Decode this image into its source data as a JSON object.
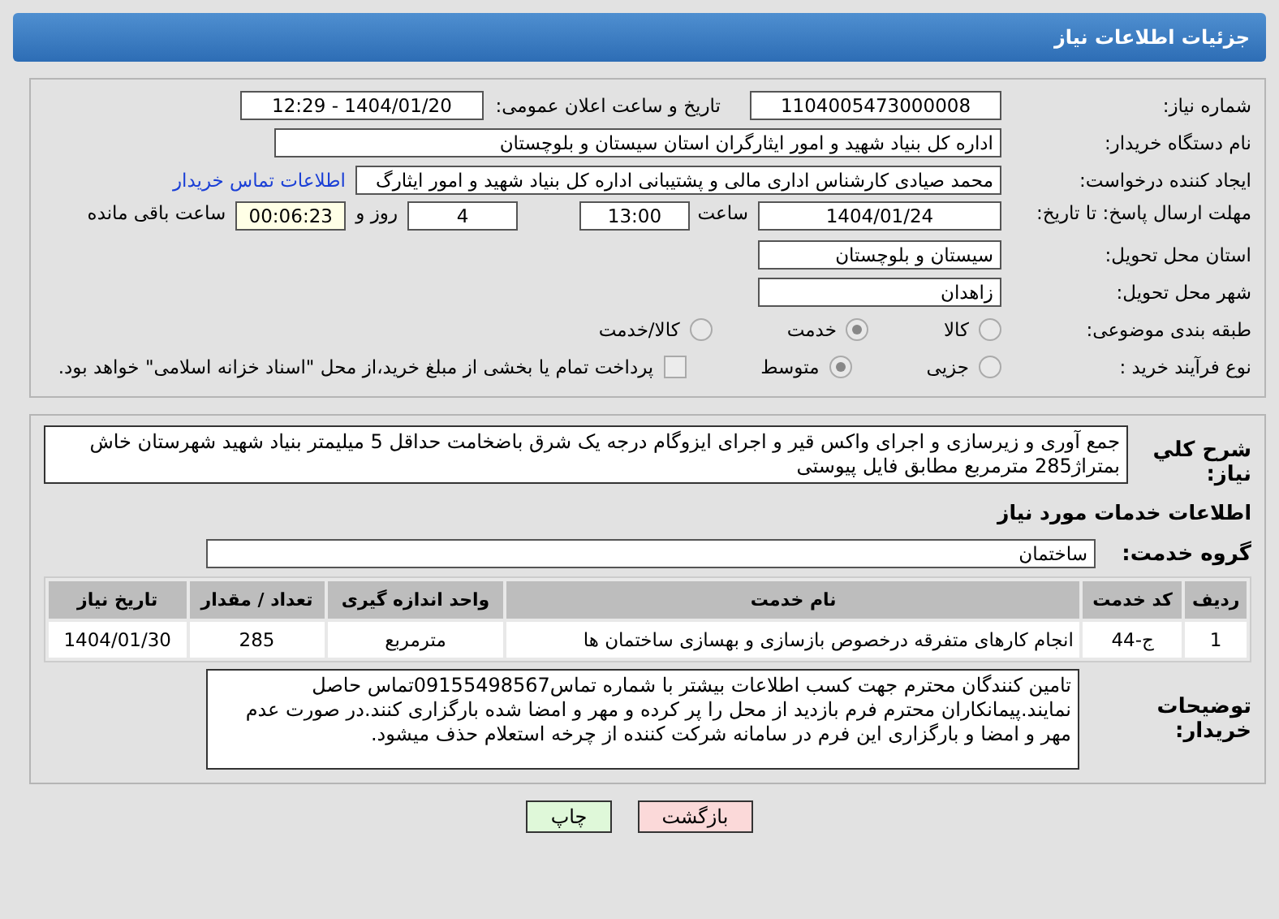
{
  "header": {
    "title": "جزئیات اطلاعات نیاز"
  },
  "details": {
    "need_number": {
      "label": "شماره نیاز:",
      "value": "1104005473000008"
    },
    "announce": {
      "label": "تاریخ و ساعت اعلان عمومی:",
      "value": "1404/01/20 - 12:29"
    },
    "buyer": {
      "label": "نام دستگاه خریدار:",
      "value": "اداره کل بنیاد شهید و امور ایثارگران استان سیستان و بلوچستان"
    },
    "creator": {
      "label": "ایجاد کننده درخواست:",
      "value": "محمد صیادی کارشناس اداری مالی و پشتیبانی اداره کل بنیاد شهید و امور ایثارگ",
      "link": "اطلاعات تماس خریدار"
    },
    "deadline": {
      "label": "مهلت ارسال پاسخ: تا تاریخ:",
      "date": "1404/01/24",
      "time_label": "ساعت",
      "time": "13:00",
      "days": "4",
      "days_label": "روز و",
      "remaining": "00:06:23",
      "remaining_label": "ساعت باقی مانده"
    },
    "province": {
      "label": "استان محل تحویل:",
      "value": "سیستان و بلوچستان"
    },
    "city": {
      "label": "شهر محل تحویل:",
      "value": "زاهدان"
    },
    "category": {
      "label": "طبقه بندی موضوعی:",
      "options": [
        {
          "label": "کالا",
          "selected": false
        },
        {
          "label": "خدمت",
          "selected": true
        },
        {
          "label": "کالا/خدمت",
          "selected": false
        }
      ]
    },
    "process": {
      "label": "نوع فرآیند خرید :",
      "options": [
        {
          "label": "جزیی",
          "selected": false
        },
        {
          "label": "متوسط",
          "selected": true
        }
      ],
      "payment": {
        "label": "پرداخت تمام یا بخشی از مبلغ خرید،از محل \"اسناد خزانه اسلامی\" خواهد بود.",
        "checked": false
      }
    }
  },
  "needs": {
    "summary": {
      "label": "شرح کلي نياز:",
      "value": "جمع آوری و زیرسازی و اجرای واکس قیر و اجرای ایزوگام درجه یک شرق باضخامت حداقل 5 میلیمتر بنیاد شهید شهرستان خاش بمتراژ285 مترمربع مطابق فایل پیوستی"
    },
    "section_title": "اطلاعات خدمات مورد نیاز",
    "service_group": {
      "label": "گروه خدمت:",
      "value": "ساختمان"
    },
    "table": {
      "columns": [
        "ردیف",
        "کد خدمت",
        "نام خدمت",
        "واحد اندازه گیری",
        "تعداد / مقدار",
        "تاریخ نیاز"
      ],
      "rows": [
        [
          "1",
          "ج-44",
          "انجام کارهای متفرقه درخصوص بازسازی و بهسازی ساختمان ها",
          "مترمربع",
          "285",
          "1404/01/30"
        ]
      ]
    },
    "buyer_notes": {
      "label": "توضیحات خریدار:",
      "value": "تامین کنندگان محترم جهت کسب اطلاعات بیشتر با شماره تماس09155498567تماس حاصل نمایند.پیمانکاران محترم فرم بازدید از محل را پر کرده و مهر و امضا شده بارگزاری کنند.در صورت عدم مهر و امضا و بارگزاری این فرم در سامانه شرکت کننده از چرخه استعلام حذف میشود."
    }
  },
  "buttons": [
    {
      "label": "بازگشت",
      "kind": "back"
    },
    {
      "label": "چاپ",
      "kind": "print"
    }
  ]
}
